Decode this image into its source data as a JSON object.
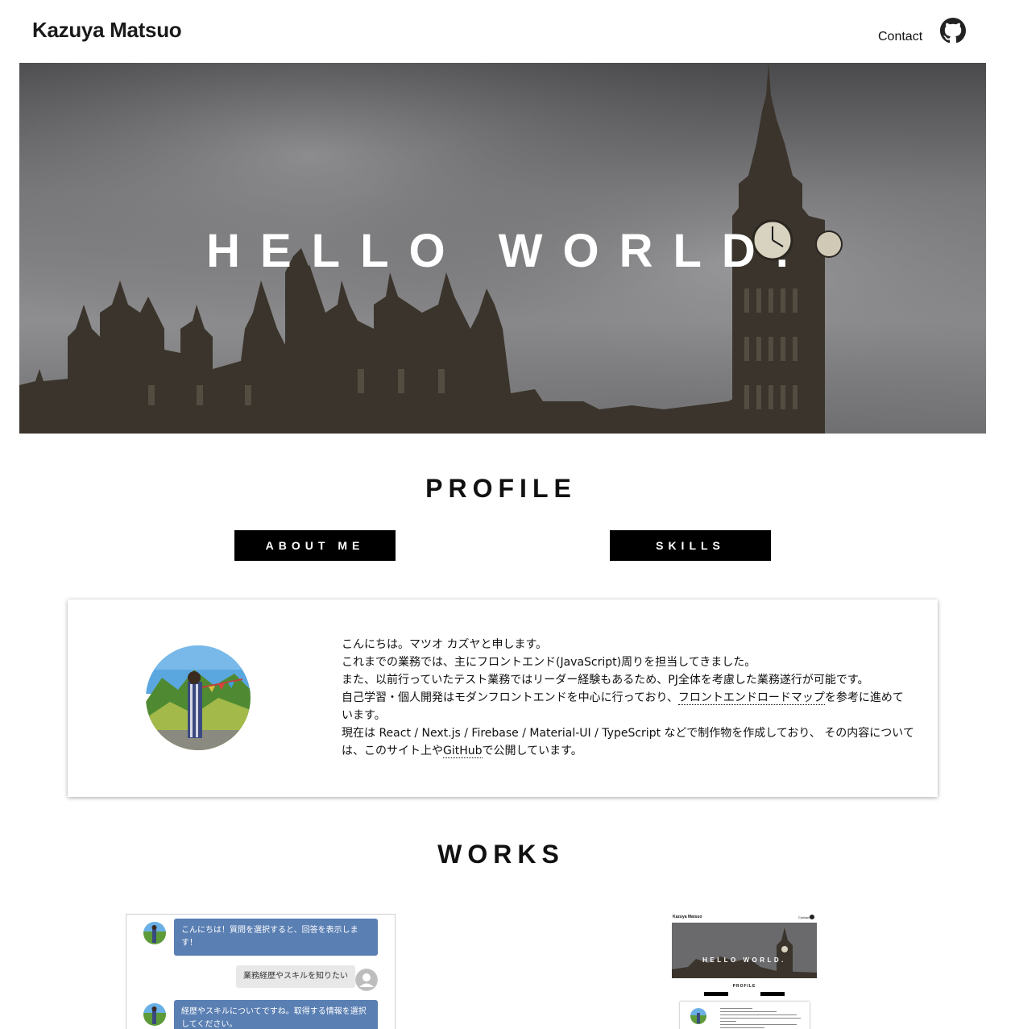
{
  "header": {
    "title": "Kazuya Matsuo",
    "nav_contact": "Contact",
    "github_icon": "github-icon"
  },
  "hero": {
    "title": "HELLO WORLD."
  },
  "profile": {
    "heading": "PROFILE",
    "tabs": [
      "ABOUT ME",
      "SKILLS"
    ],
    "intro": {
      "line1": "こんにちは。マツオ カズヤと申します。",
      "line2": "これまでの業務では、主にフロントエンド(JavaScript)周りを担当してきました。",
      "line3": "また、以前行っていたテスト業務ではリーダー経験もあるため、PJ全体を考慮した業務遂行が可能です。",
      "line4_pre": "自己学習・個人開発はモダンフロントエンドを中心に行っており、",
      "line4_link": "フロントエンドロードマップ",
      "line4_post": "を参考に進めて",
      "line5": "います。",
      "line6": "現在は React / Next.js / Firebase / Material-UI / TypeScript などで制作物を作成しており、 その内容について",
      "line7_pre": "は、このサイト上や",
      "line7_link": "GitHub",
      "line7_post": "で公開しています。"
    }
  },
  "works": {
    "heading": "WORKS",
    "chatbot": {
      "bot_message_1": "こんにちは！質問を選択すると、回答を表示します！",
      "user_message": "業務経歴やスキルを知りたい",
      "bot_message_2": "経歴やスキルについてですね。取得する情報を選択してください。"
    },
    "portfolio_thumb": {
      "title": "Kazuya Matsuo",
      "contact": "Contact",
      "hero": "HELLO WORLD.",
      "profile": "PROFILE"
    }
  },
  "colors": {
    "accent": "#000000",
    "chat_bubble": "#5a7fb3",
    "hero_overlay": "#6b6b6d"
  }
}
